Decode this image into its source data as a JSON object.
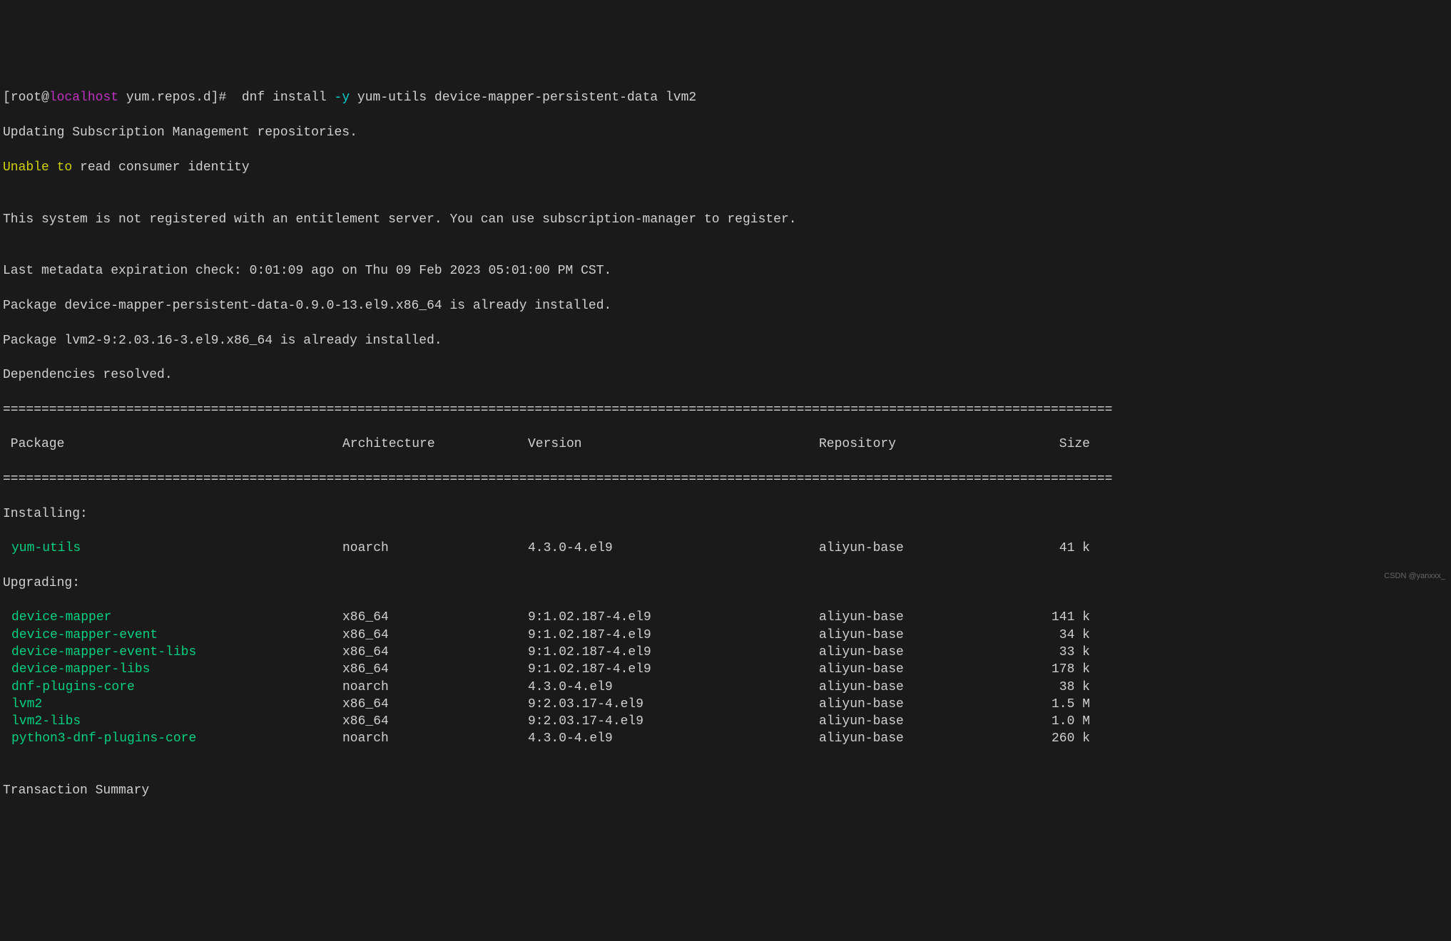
{
  "prompt": {
    "bracket_open": "[",
    "user": "root@",
    "host": "localhost",
    "path": " yum.repos.d",
    "bracket_close": "]# ",
    "command": " dnf install ",
    "flag": "-y",
    "args": " yum-utils device-mapper-persistent-data lvm2"
  },
  "lines": {
    "updating": "Updating Subscription Management repositories.",
    "unable": "Unable to",
    "unable_rest": " read consumer identity",
    "blank1": "",
    "not_registered": "This system is not registered with an entitlement server. You can use subscription-manager to register.",
    "blank2": "",
    "last_check": "Last metadata expiration check: 0:01:09 ago on Thu 09 Feb 2023 05:01:00 PM CST.",
    "pkg1": "Package device-mapper-persistent-data-0.9.0-13.el9.x86_64 is already installed.",
    "pkg2": "Package lvm2-9:2.03.16-3.el9.x86_64 is already installed.",
    "deps": "Dependencies resolved.",
    "installing": "Installing:",
    "upgrading": "Upgrading:",
    "blank3": "",
    "txn": "Transaction Summary"
  },
  "hr": "================================================================================================================================================",
  "headers": {
    "package": " Package",
    "arch": "Architecture",
    "version": "Version",
    "repo": "Repository",
    "size": "Size"
  },
  "installing": [
    {
      "name": "yum-utils",
      "arch": "noarch",
      "version": "4.3.0-4.el9",
      "repo": "aliyun-base",
      "size": "41 k"
    }
  ],
  "upgrading": [
    {
      "name": "device-mapper",
      "arch": "x86_64",
      "version": "9:1.02.187-4.el9",
      "repo": "aliyun-base",
      "size": "141 k"
    },
    {
      "name": "device-mapper-event",
      "arch": "x86_64",
      "version": "9:1.02.187-4.el9",
      "repo": "aliyun-base",
      "size": "34 k"
    },
    {
      "name": "device-mapper-event-libs",
      "arch": "x86_64",
      "version": "9:1.02.187-4.el9",
      "repo": "aliyun-base",
      "size": "33 k"
    },
    {
      "name": "device-mapper-libs",
      "arch": "x86_64",
      "version": "9:1.02.187-4.el9",
      "repo": "aliyun-base",
      "size": "178 k"
    },
    {
      "name": "dnf-plugins-core",
      "arch": "noarch",
      "version": "4.3.0-4.el9",
      "repo": "aliyun-base",
      "size": "38 k"
    },
    {
      "name": "lvm2",
      "arch": "x86_64",
      "version": "9:2.03.17-4.el9",
      "repo": "aliyun-base",
      "size": "1.5 M"
    },
    {
      "name": "lvm2-libs",
      "arch": "x86_64",
      "version": "9:2.03.17-4.el9",
      "repo": "aliyun-base",
      "size": "1.0 M"
    },
    {
      "name": "python3-dnf-plugins-core",
      "arch": "noarch",
      "version": "4.3.0-4.el9",
      "repo": "aliyun-base",
      "size": "260 k"
    }
  ],
  "watermark": "CSDN @yanxxx_"
}
